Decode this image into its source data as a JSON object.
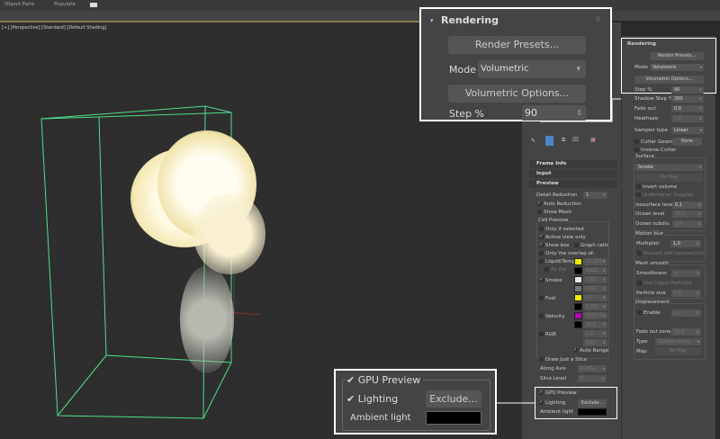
{
  "menubar": {
    "items": [
      "Object Paint",
      "Populate"
    ]
  },
  "viewport": {
    "label": "[+] [Perspective] [Standard] [Default Shading]"
  },
  "left_panel": {
    "rollouts": [
      "Frame Info",
      "Input",
      "Preview"
    ],
    "detail_reduction_label": "Detail Reduction",
    "detail_reduction": "1",
    "auto_reduction": "Auto Reduction",
    "show_mesh": "Show Mesh",
    "cell_preview": "Cell Preview",
    "only_if_selected": "Only if selected",
    "active_view_only": "Active view only",
    "show_box": "Show box",
    "graph_cells": "Graph cells",
    "only_overlap": "Only the overlap of:",
    "channels": [
      {
        "label": "Liquid/Temp.",
        "color1": "#f2e800",
        "v1": "11,241",
        "color2": "#000000",
        "v2": "0,021"
      },
      {
        "label": "Smoke",
        "color1": "#e8e8e8",
        "v1": "7,91",
        "color2": "#777777",
        "v2": "0,01"
      },
      {
        "label": "Fuel",
        "color1": "#f2e800",
        "v1": "0,0",
        "color2": "#000000",
        "v2": "0,001"
      },
      {
        "label": "Velocity",
        "color1": "#b000b0",
        "v1": "1000,0",
        "color2": "#000000",
        "v2": "10,0"
      },
      {
        "label": "RGB",
        "color1": "",
        "v1": "1,0",
        "color2": "",
        "v2": "0,01"
      }
    ],
    "as_fire": "As fire",
    "auto_range": "Auto Range",
    "draw_slice": "Draw Just a Slice",
    "along_axis_label": "Along Axis",
    "along_axis": "X Axis",
    "slice_level_label": "Slice Level",
    "slice_level": "0",
    "gpu_preview": "GPU Preview",
    "lighting": "Lighting",
    "exclude": "Exclude...",
    "ambient_light": "Ambient light"
  },
  "right_panel": {
    "title": "Rendering",
    "render_presets": "Render Presets...",
    "mode_label": "Mode",
    "mode": "Volumetric",
    "volumetric_options": "Volumetric Options...",
    "step_label": "Step %",
    "step": "90",
    "shadow_step_label": "Shadow Step %",
    "shadow_step": "200",
    "fade_out_label": "Fade out",
    "fade_out": "0,0",
    "heathaze_label": "Heathaze",
    "heathaze": "1,0",
    "sampler_label": "Sampler type",
    "sampler": "Linear",
    "cutter_geom": "Cutter Geom",
    "none": "None",
    "inverse_cutter": "Inverse Cutter",
    "surface": "Surface",
    "surface_type": "Smoke",
    "no_map": "No Map",
    "invert_volume": "Invert volume",
    "underwater": "Underwater Goggles",
    "isosurface_label": "Isosurface level",
    "isosurface": "0,1",
    "ocean_level_label": "Ocean level",
    "ocean_level": "50,0",
    "ocean_subdiv_label": "Ocean subdiv.",
    "ocean_subdiv": "2,0",
    "motion_blur": "Motion blur",
    "multiplier_label": "Multiplier",
    "multiplier": "1,0",
    "prevent_self": "Prevent self intersection",
    "mesh_smooth": "Mesh smooth",
    "smoothness_label": "Smoothness",
    "smoothness": "0",
    "use_liquid": "Use Liquid Particles",
    "particle_size_label": "Particle size",
    "particle_size": "0,5",
    "displacement": "Displacement",
    "enable": "Enable",
    "enable_val": "1,0",
    "fade_zone_label": "Fade out zone",
    "fade_zone": "20,0",
    "type_label": "Type",
    "type": "Surface driven",
    "map_label": "Map",
    "map": "No Map"
  }
}
